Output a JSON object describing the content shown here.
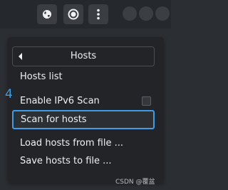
{
  "menu": {
    "header": "Hosts",
    "items": [
      "Hosts list",
      "Enable IPv6 Scan",
      "Scan for hosts",
      "Load hosts from file ...",
      "Save hosts to file ..."
    ],
    "selected_index": 2,
    "ipv6_checked": false
  },
  "annotation": "4",
  "watermark": "CSDN @覆盆",
  "colors": {
    "accent": "#3d9ee6",
    "background": "#2b2e33",
    "menu_bg": "#222428"
  },
  "icons": {
    "globe": "globe-icon",
    "record": "record-icon",
    "kebab": "kebab-menu-icon"
  }
}
